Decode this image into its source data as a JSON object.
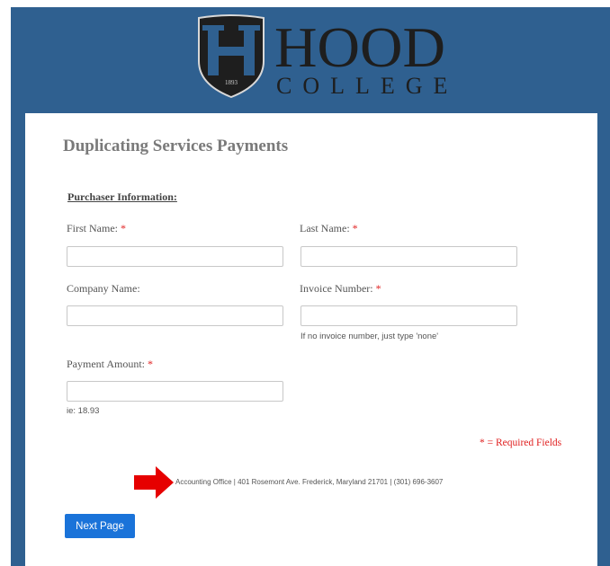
{
  "header": {
    "logo_name": "HOOD",
    "logo_sub": "COLLEGE",
    "logo_year": "1893",
    "brand_color": "#2f6090"
  },
  "form": {
    "title": "Duplicating Services Payments",
    "section_title": "Purchaser Information:",
    "first_name": {
      "label": "First Name:",
      "required": "*",
      "value": ""
    },
    "last_name": {
      "label": "Last Name:",
      "required": "*",
      "value": ""
    },
    "company_name": {
      "label": "Company Name:",
      "value": ""
    },
    "invoice_number": {
      "label": "Invoice Number:",
      "required": "*",
      "value": "",
      "hint": "If no invoice number, just type 'none'"
    },
    "payment_amount": {
      "label": "Payment Amount:",
      "required": "*",
      "value": "",
      "hint": "ie: 18.93"
    },
    "required_note": "* = Required Fields"
  },
  "footer": {
    "address": "Accounting Office | 401 Rosemont Ave. Frederick, Maryland 21701 | (301) 696-3607",
    "arrow_icon": "red-arrow-right-icon"
  },
  "actions": {
    "next_label": "Next Page",
    "button_color": "#1a73d9"
  }
}
